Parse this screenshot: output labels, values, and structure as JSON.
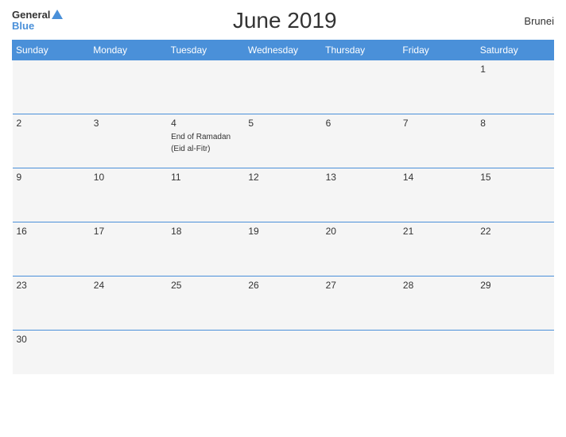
{
  "header": {
    "logo_general": "General",
    "logo_blue": "Blue",
    "title": "June 2019",
    "country": "Brunei"
  },
  "weekdays": [
    "Sunday",
    "Monday",
    "Tuesday",
    "Wednesday",
    "Thursday",
    "Friday",
    "Saturday"
  ],
  "weeks": [
    [
      {
        "day": "",
        "event": ""
      },
      {
        "day": "",
        "event": ""
      },
      {
        "day": "",
        "event": ""
      },
      {
        "day": "",
        "event": ""
      },
      {
        "day": "",
        "event": ""
      },
      {
        "day": "",
        "event": ""
      },
      {
        "day": "1",
        "event": ""
      }
    ],
    [
      {
        "day": "2",
        "event": ""
      },
      {
        "day": "3",
        "event": ""
      },
      {
        "day": "4",
        "event": "End of Ramadan (Eid al-Fitr)"
      },
      {
        "day": "5",
        "event": ""
      },
      {
        "day": "6",
        "event": ""
      },
      {
        "day": "7",
        "event": ""
      },
      {
        "day": "8",
        "event": ""
      }
    ],
    [
      {
        "day": "9",
        "event": ""
      },
      {
        "day": "10",
        "event": ""
      },
      {
        "day": "11",
        "event": ""
      },
      {
        "day": "12",
        "event": ""
      },
      {
        "day": "13",
        "event": ""
      },
      {
        "day": "14",
        "event": ""
      },
      {
        "day": "15",
        "event": ""
      }
    ],
    [
      {
        "day": "16",
        "event": ""
      },
      {
        "day": "17",
        "event": ""
      },
      {
        "day": "18",
        "event": ""
      },
      {
        "day": "19",
        "event": ""
      },
      {
        "day": "20",
        "event": ""
      },
      {
        "day": "21",
        "event": ""
      },
      {
        "day": "22",
        "event": ""
      }
    ],
    [
      {
        "day": "23",
        "event": ""
      },
      {
        "day": "24",
        "event": ""
      },
      {
        "day": "25",
        "event": ""
      },
      {
        "day": "26",
        "event": ""
      },
      {
        "day": "27",
        "event": ""
      },
      {
        "day": "28",
        "event": ""
      },
      {
        "day": "29",
        "event": ""
      }
    ],
    [
      {
        "day": "30",
        "event": ""
      },
      {
        "day": "",
        "event": ""
      },
      {
        "day": "",
        "event": ""
      },
      {
        "day": "",
        "event": ""
      },
      {
        "day": "",
        "event": ""
      },
      {
        "day": "",
        "event": ""
      },
      {
        "day": "",
        "event": ""
      }
    ]
  ]
}
